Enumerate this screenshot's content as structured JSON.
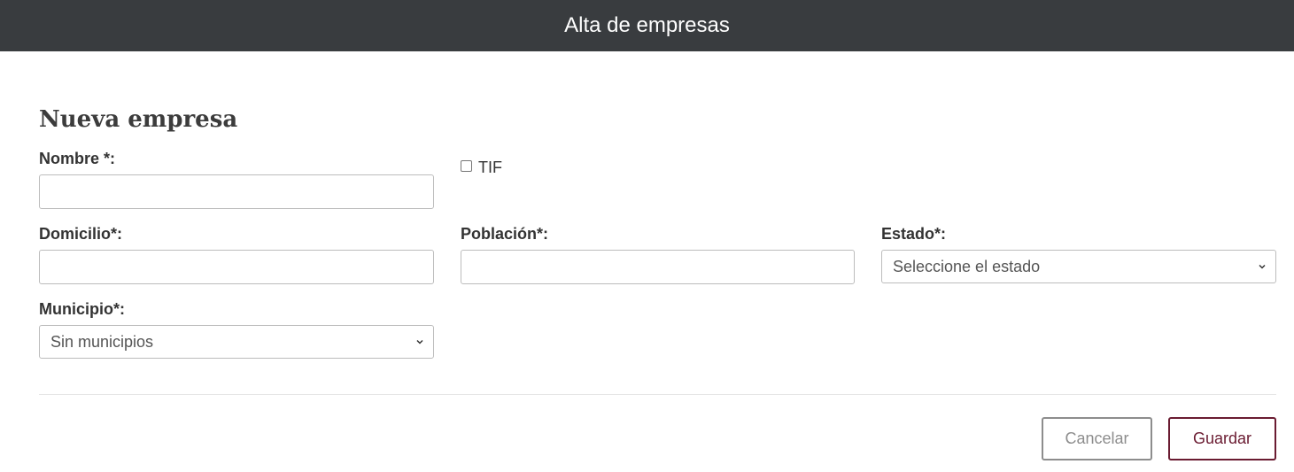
{
  "header": {
    "title": "Alta de empresas"
  },
  "form": {
    "title": "Nueva empresa",
    "nombre": {
      "label": "Nombre *:",
      "value": "",
      "placeholder": ""
    },
    "tif": {
      "label": "TIF",
      "checked": false
    },
    "domicilio": {
      "label": "Domicilio*:",
      "value": "",
      "placeholder": ""
    },
    "poblacion": {
      "label": "Población*:",
      "value": "",
      "placeholder": ""
    },
    "estado": {
      "label": "Estado*:",
      "selected": "Seleccione el estado"
    },
    "municipio": {
      "label": "Municipio*:",
      "selected": "Sin municipios"
    }
  },
  "actions": {
    "cancel_label": "Cancelar",
    "save_label": "Guardar"
  },
  "colors": {
    "header_bg": "#393c3f",
    "save_accent": "#6a1b31",
    "cancel_gray": "#8d8d8d"
  },
  "icons": {
    "select_arrow": "chevron-down-icon"
  }
}
